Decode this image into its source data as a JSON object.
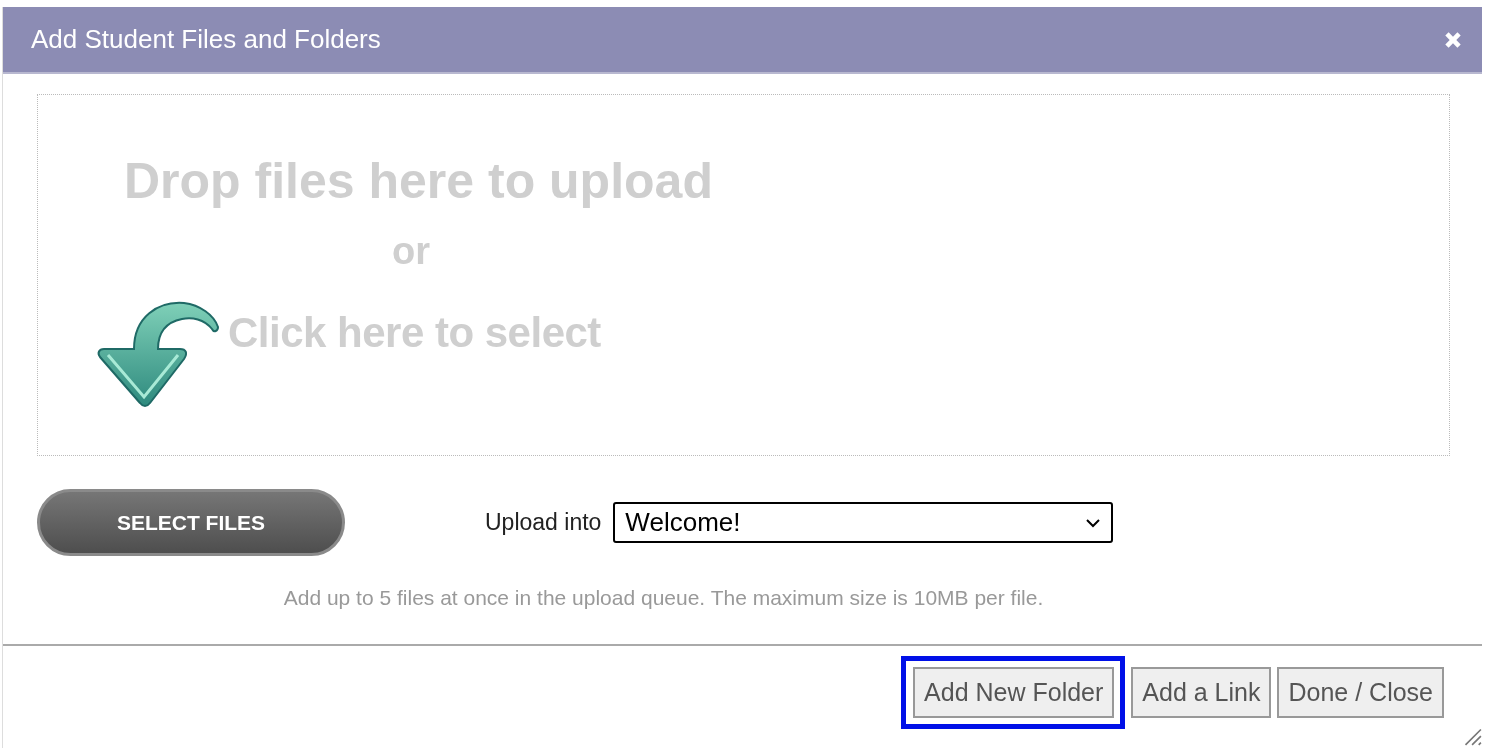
{
  "window": {
    "title": "Add Student Files and Folders"
  },
  "drop_zone": {
    "heading": "Drop files here to upload",
    "separator": "or",
    "action": "Click here to select"
  },
  "select_files_button": "SELECT FILES",
  "upload_into": {
    "label": "Upload into",
    "value": "Welcome!"
  },
  "hint": "Add up to 5 files at once in the upload queue. The maximum size is 10MB per file.",
  "buttons": [
    {
      "label": "Add New Folder",
      "highlighted": true
    },
    {
      "label": "Add a Link",
      "highlighted": false
    },
    {
      "label": "Done / Close",
      "highlighted": false
    }
  ]
}
